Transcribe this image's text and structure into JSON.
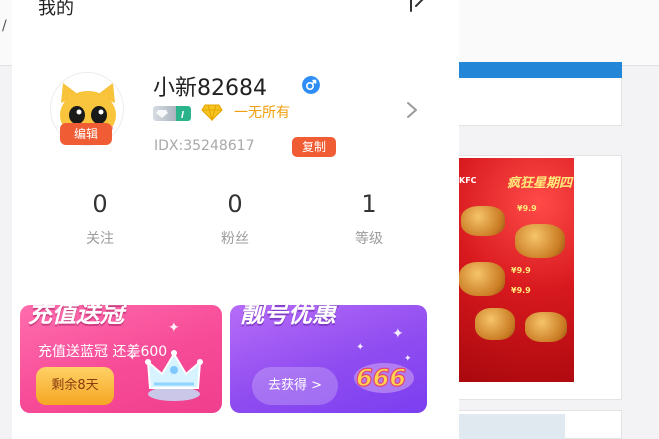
{
  "panel": {
    "title": "我的",
    "user": {
      "username": "小新82684",
      "gender_icon": "male-icon",
      "wealth_label": "一无所有",
      "idx": "IDX:35248617",
      "copy_label": "复制",
      "edit_label": "编辑"
    },
    "stats": [
      {
        "value": "0",
        "label": "关注"
      },
      {
        "value": "0",
        "label": "粉丝"
      },
      {
        "value": "1",
        "label": "等级"
      }
    ],
    "promos": [
      {
        "title": "充值送冠",
        "subtitle": "充值送蓝冠 还差600",
        "button": "剩余8天",
        "icon": "crown-icon"
      },
      {
        "title": "靓号优惠",
        "button": "去获得 >",
        "icon": "number-666-icon",
        "icon_text": "666"
      }
    ]
  },
  "background": {
    "ad": {
      "brand": "KFC",
      "title": "疯狂星期四"
    }
  },
  "colors": {
    "accent_orange": "#f05c33",
    "gold": "#f0a010",
    "pink_promo": "#f74b97",
    "purple_promo": "#8f4cf0",
    "male_blue": "#2f8ef6"
  }
}
